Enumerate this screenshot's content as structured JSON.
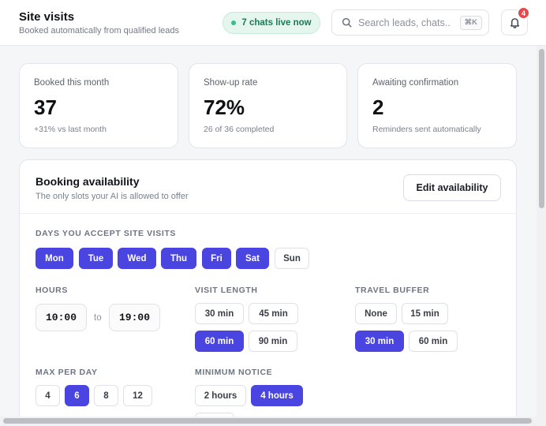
{
  "header": {
    "title": "Site visits",
    "subtitle": "Booked automatically from qualified leads",
    "live_label": "7 chats live now",
    "search_placeholder": "Search leads, chats...",
    "search_shortcut": "⌘K",
    "notification_count": "4"
  },
  "stats": [
    {
      "label": "Booked this month",
      "value": "37",
      "note": "+31% vs last month"
    },
    {
      "label": "Show-up rate",
      "value": "72%",
      "note": "26 of 36 completed"
    },
    {
      "label": "Awaiting confirmation",
      "value": "2",
      "note": "Reminders sent automatically"
    }
  ],
  "availability": {
    "title": "Booking availability",
    "subtitle": "The only slots your AI is allowed to offer",
    "edit_label": "Edit availability",
    "days_label": "Days you accept site visits",
    "days": [
      {
        "label": "Mon",
        "selected": true
      },
      {
        "label": "Tue",
        "selected": true
      },
      {
        "label": "Wed",
        "selected": true
      },
      {
        "label": "Thu",
        "selected": true
      },
      {
        "label": "Fri",
        "selected": true
      },
      {
        "label": "Sat",
        "selected": true
      },
      {
        "label": "Sun",
        "selected": false
      }
    ],
    "hours_label": "Hours",
    "hours_from": "10:00",
    "hours_to_label": "to",
    "hours_to": "19:00",
    "visit_length_label": "Visit length",
    "visit_length_options": [
      {
        "label": "30 min",
        "selected": false
      },
      {
        "label": "45 min",
        "selected": false
      },
      {
        "label": "60 min",
        "selected": true
      },
      {
        "label": "90 min",
        "selected": false
      }
    ],
    "travel_buffer_label": "Travel buffer",
    "travel_buffer_options": [
      {
        "label": "None",
        "selected": false
      },
      {
        "label": "15 min",
        "selected": false
      },
      {
        "label": "30 min",
        "selected": true
      },
      {
        "label": "60 min",
        "selected": false
      }
    ],
    "max_per_day_label": "Max per day",
    "max_per_day_options": [
      {
        "label": "4",
        "selected": false
      },
      {
        "label": "6",
        "selected": true
      },
      {
        "label": "8",
        "selected": false
      },
      {
        "label": "12",
        "selected": false
      }
    ],
    "min_notice_label": "Minimum notice",
    "min_notice_options": [
      {
        "label": "2 hours",
        "selected": false
      },
      {
        "label": "4 hours",
        "selected": true
      }
    ]
  },
  "colors": {
    "accent": "#4a45e0",
    "live_green": "#36c08a",
    "badge_red": "#e5484d"
  },
  "icons": {
    "search": "search-icon",
    "bell": "bell-icon"
  }
}
